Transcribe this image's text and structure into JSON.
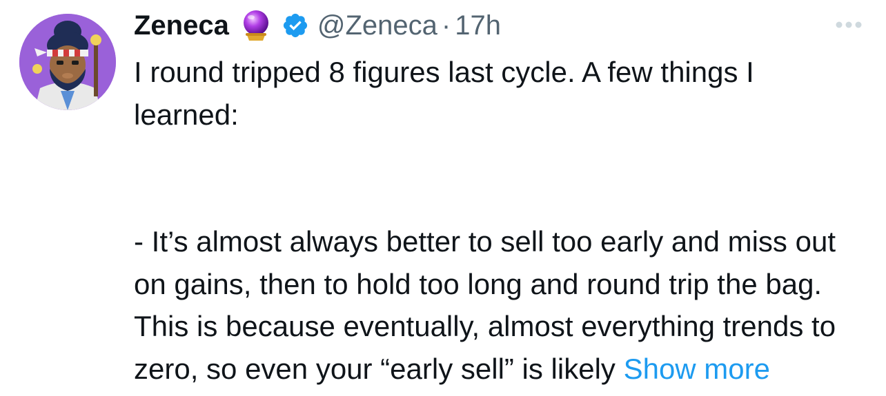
{
  "tweet": {
    "display_name": "Zeneca",
    "emoji_badge": "crystal-ball-icon",
    "verified_icon": "verified-badge-icon",
    "handle": "@Zeneca",
    "separator": "·",
    "time": "17h",
    "more_icon": "more-options-icon",
    "line1": "I round tripped 8 figures last cycle. A few things I learned:",
    "paragraph2": "- It’s almost always better to sell too early and miss out on gains, then to hold too long and round trip the bag. This is because eventually, almost everything trends to zero, so even your “early sell” is likely",
    "show_more": "Show more"
  },
  "colors": {
    "text": "#0f1419",
    "secondary": "#536471",
    "accent": "#1d9bf0",
    "avatar_bg": "#9a61d9"
  }
}
